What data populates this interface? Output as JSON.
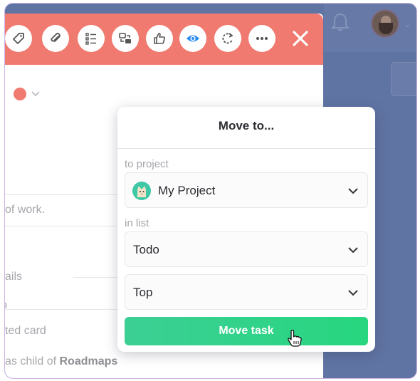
{
  "toolbar": {
    "buttons": [
      {
        "name": "tag-icon"
      },
      {
        "name": "attachment-icon"
      },
      {
        "name": "checklist-icon"
      },
      {
        "name": "swap-icon"
      },
      {
        "name": "thumbs-up-icon"
      },
      {
        "name": "eye-icon"
      },
      {
        "name": "repeat-icon"
      },
      {
        "name": "more-icon"
      }
    ],
    "close_icon": "close-icon",
    "background_color": "#f07a70"
  },
  "panel": {
    "color_label_color": "#f07a70",
    "text_work": "of work.",
    "text_details": "ails",
    "text_o": "o",
    "text_card": "ted card",
    "text_child_prefix": "as child of ",
    "text_child_parent": "Roadmaps"
  },
  "dialog": {
    "title": "Move to...",
    "project_label": "to project",
    "project_value": "My Project",
    "list_label": "in list",
    "list_value": "Todo",
    "position_value": "Top",
    "submit_label": "Move task",
    "submit_color": "#2fd38a"
  }
}
